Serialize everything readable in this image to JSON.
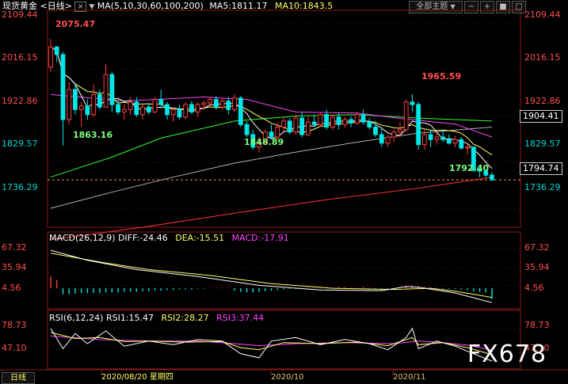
{
  "header": {
    "instrument": "现货黄金",
    "period": "<日线>",
    "ma_legend": "MA(5,10,30,60,100,200)",
    "ma5_label": "MA5:1811.17",
    "ma10_label": "MA10:1843.5",
    "subject_button": "全部主题",
    "dropdown_glyph": "▼",
    "close_glyph": "×"
  },
  "macd": {
    "title": "MACD(26,12,9)",
    "diff_label": "DIFF:-24.46",
    "dea_label": "DEA:-15.51",
    "macd_label": "MACD:-17.91",
    "levels": [
      "67.32",
      "35.94",
      "4.56"
    ]
  },
  "rsi": {
    "title": "RSI(6,12,24)",
    "rsi1_label": "RSI1:15.47",
    "rsi2_label": "RSI2:28.27",
    "rsi3_label": "RSI3:37.44",
    "levels": [
      "78.73",
      "47.10"
    ]
  },
  "price_axis": {
    "levels": [
      "2109.44",
      "2016.15",
      "1922.86",
      "1829.57",
      "1736.29"
    ],
    "current_box": "1904.41",
    "last_price_box": "1794.74"
  },
  "annotations": {
    "high": "2075.47",
    "low1": "1863.16",
    "low2": "1848.89",
    "high2": "1965.59",
    "low3": "1792.40"
  },
  "x_axis": {
    "period_button": "日线",
    "labels": [
      "2020/08/20 星期四",
      "2020/10",
      "2020/11"
    ]
  },
  "watermark": "FX678",
  "colors": {
    "up": "#ff3d3d",
    "down": "#00e6e6",
    "ma5": "#ffffff",
    "ma10": "#ffff66",
    "ma30": "#ff44ff",
    "ma60": "#33ff33",
    "ma100": "#b0b0b0",
    "ma200": "#ff3333",
    "diff": "#ffffff",
    "dea": "#ffff66",
    "rsi3": "#ff44ff"
  },
  "chart_data": [
    {
      "type": "candlestick",
      "title": "现货黄金 日线",
      "y_range": [
        1700,
        2130
      ],
      "candles": [
        {
          "o": 2020,
          "h": 2075.47,
          "l": 2010,
          "c": 2060
        },
        {
          "o": 2060,
          "h": 2062,
          "l": 2030,
          "c": 2045
        },
        {
          "o": 2045,
          "h": 2050,
          "l": 1863.16,
          "c": 1915
        },
        {
          "o": 1915,
          "h": 1990,
          "l": 1905,
          "c": 1975
        },
        {
          "o": 1975,
          "h": 1985,
          "l": 1925,
          "c": 1935
        },
        {
          "o": 1935,
          "h": 1950,
          "l": 1900,
          "c": 1942
        },
        {
          "o": 1942,
          "h": 1955,
          "l": 1915,
          "c": 1925
        },
        {
          "o": 1925,
          "h": 1985,
          "l": 1920,
          "c": 1965
        },
        {
          "o": 1965,
          "h": 1975,
          "l": 1935,
          "c": 1940
        },
        {
          "o": 1940,
          "h": 2025,
          "l": 1938,
          "c": 2005
        },
        {
          "o": 2005,
          "h": 2010,
          "l": 1930,
          "c": 1945
        },
        {
          "o": 1945,
          "h": 1955,
          "l": 1925,
          "c": 1930
        },
        {
          "o": 1930,
          "h": 1945,
          "l": 1915,
          "c": 1935
        },
        {
          "o": 1935,
          "h": 1960,
          "l": 1925,
          "c": 1950
        },
        {
          "o": 1950,
          "h": 1960,
          "l": 1920,
          "c": 1925
        },
        {
          "o": 1925,
          "h": 1945,
          "l": 1915,
          "c": 1940
        },
        {
          "o": 1940,
          "h": 1948,
          "l": 1925,
          "c": 1930
        },
        {
          "o": 1930,
          "h": 1960,
          "l": 1928,
          "c": 1955
        },
        {
          "o": 1955,
          "h": 1975,
          "l": 1940,
          "c": 1945
        },
        {
          "o": 1945,
          "h": 1950,
          "l": 1915,
          "c": 1925
        },
        {
          "o": 1925,
          "h": 1940,
          "l": 1910,
          "c": 1935
        },
        {
          "o": 1935,
          "h": 1945,
          "l": 1915,
          "c": 1920
        },
        {
          "o": 1920,
          "h": 1950,
          "l": 1915,
          "c": 1945
        },
        {
          "o": 1945,
          "h": 1952,
          "l": 1925,
          "c": 1930
        },
        {
          "o": 1930,
          "h": 1950,
          "l": 1920,
          "c": 1945
        },
        {
          "o": 1945,
          "h": 1952,
          "l": 1935,
          "c": 1948
        },
        {
          "o": 1948,
          "h": 1960,
          "l": 1940,
          "c": 1955
        },
        {
          "o": 1955,
          "h": 1962,
          "l": 1935,
          "c": 1940
        },
        {
          "o": 1940,
          "h": 1958,
          "l": 1935,
          "c": 1952
        },
        {
          "o": 1952,
          "h": 1960,
          "l": 1925,
          "c": 1935
        },
        {
          "o": 1935,
          "h": 1965,
          "l": 1930,
          "c": 1958
        },
        {
          "o": 1958,
          "h": 1962,
          "l": 1900,
          "c": 1905
        },
        {
          "o": 1905,
          "h": 1912,
          "l": 1880,
          "c": 1885
        },
        {
          "o": 1885,
          "h": 1895,
          "l": 1855,
          "c": 1860
        },
        {
          "o": 1860,
          "h": 1880,
          "l": 1848.89,
          "c": 1870
        },
        {
          "o": 1870,
          "h": 1895,
          "l": 1865,
          "c": 1890
        },
        {
          "o": 1890,
          "h": 1905,
          "l": 1875,
          "c": 1880
        },
        {
          "o": 1880,
          "h": 1910,
          "l": 1875,
          "c": 1900
        },
        {
          "o": 1900,
          "h": 1920,
          "l": 1890,
          "c": 1912
        },
        {
          "o": 1912,
          "h": 1918,
          "l": 1885,
          "c": 1890
        },
        {
          "o": 1890,
          "h": 1925,
          "l": 1885,
          "c": 1918
        },
        {
          "o": 1918,
          "h": 1930,
          "l": 1880,
          "c": 1885
        },
        {
          "o": 1885,
          "h": 1920,
          "l": 1882,
          "c": 1910
        },
        {
          "o": 1910,
          "h": 1925,
          "l": 1900,
          "c": 1905
        },
        {
          "o": 1905,
          "h": 1930,
          "l": 1900,
          "c": 1925
        },
        {
          "o": 1925,
          "h": 1935,
          "l": 1895,
          "c": 1900
        },
        {
          "o": 1900,
          "h": 1925,
          "l": 1895,
          "c": 1920
        },
        {
          "o": 1920,
          "h": 1928,
          "l": 1895,
          "c": 1905
        },
        {
          "o": 1905,
          "h": 1920,
          "l": 1898,
          "c": 1915
        },
        {
          "o": 1915,
          "h": 1922,
          "l": 1900,
          "c": 1908
        },
        {
          "o": 1908,
          "h": 1930,
          "l": 1905,
          "c": 1925
        },
        {
          "o": 1925,
          "h": 1935,
          "l": 1905,
          "c": 1910
        },
        {
          "o": 1910,
          "h": 1918,
          "l": 1895,
          "c": 1900
        },
        {
          "o": 1900,
          "h": 1912,
          "l": 1880,
          "c": 1885
        },
        {
          "o": 1885,
          "h": 1900,
          "l": 1860,
          "c": 1868
        },
        {
          "o": 1868,
          "h": 1885,
          "l": 1860,
          "c": 1880
        },
        {
          "o": 1880,
          "h": 1895,
          "l": 1870,
          "c": 1890
        },
        {
          "o": 1890,
          "h": 1910,
          "l": 1880,
          "c": 1895
        },
        {
          "o": 1895,
          "h": 1955,
          "l": 1890,
          "c": 1950
        },
        {
          "o": 1950,
          "h": 1965.59,
          "l": 1930,
          "c": 1945
        },
        {
          "o": 1945,
          "h": 1950,
          "l": 1855,
          "c": 1865
        },
        {
          "o": 1865,
          "h": 1895,
          "l": 1855,
          "c": 1885
        },
        {
          "o": 1885,
          "h": 1895,
          "l": 1860,
          "c": 1875
        },
        {
          "o": 1875,
          "h": 1890,
          "l": 1865,
          "c": 1880
        },
        {
          "o": 1880,
          "h": 1895,
          "l": 1870,
          "c": 1875
        },
        {
          "o": 1875,
          "h": 1885,
          "l": 1865,
          "c": 1868
        },
        {
          "o": 1868,
          "h": 1882,
          "l": 1860,
          "c": 1875
        },
        {
          "o": 1875,
          "h": 1880,
          "l": 1855,
          "c": 1858
        },
        {
          "o": 1858,
          "h": 1868,
          "l": 1845,
          "c": 1860
        },
        {
          "o": 1860,
          "h": 1862,
          "l": 1810,
          "c": 1815
        },
        {
          "o": 1815,
          "h": 1820,
          "l": 1800,
          "c": 1812
        },
        {
          "o": 1812,
          "h": 1815,
          "l": 1800,
          "c": 1804
        },
        {
          "o": 1804,
          "h": 1810,
          "l": 1792.4,
          "c": 1794.74
        }
      ],
      "ma_series": {
        "ma30": [
          [
            0,
            1965
          ],
          [
            12,
            1952
          ],
          [
            25,
            1960
          ],
          [
            32,
            1955
          ],
          [
            40,
            1930
          ],
          [
            50,
            1928
          ],
          [
            58,
            1916
          ],
          [
            66,
            1906
          ],
          [
            72,
            1880
          ]
        ],
        "ma60": [
          [
            0,
            1800
          ],
          [
            10,
            1840
          ],
          [
            18,
            1878
          ],
          [
            30,
            1912
          ],
          [
            40,
            1922
          ],
          [
            50,
            1925
          ],
          [
            60,
            1918
          ],
          [
            72,
            1912
          ]
        ],
        "ma100": [
          [
            0,
            1738
          ],
          [
            10,
            1770
          ],
          [
            20,
            1800
          ],
          [
            30,
            1828
          ],
          [
            40,
            1850
          ],
          [
            50,
            1870
          ],
          [
            60,
            1888
          ],
          [
            72,
            1900
          ]
        ],
        "ma200": [
          [
            0,
            1675
          ],
          [
            15,
            1700
          ],
          [
            30,
            1728
          ],
          [
            45,
            1755
          ],
          [
            60,
            1778
          ],
          [
            72,
            1800
          ]
        ]
      }
    },
    {
      "type": "macd",
      "title": "MACD(26,12,9)",
      "y_range": [
        -35,
        80
      ],
      "diff": [
        [
          0,
          65
        ],
        [
          6,
          48
        ],
        [
          14,
          32
        ],
        [
          24,
          20
        ],
        [
          34,
          5
        ],
        [
          44,
          -3
        ],
        [
          54,
          -4
        ],
        [
          58,
          3
        ],
        [
          60,
          2
        ],
        [
          66,
          -8
        ],
        [
          72,
          -24.46
        ]
      ],
      "dea": [
        [
          0,
          60
        ],
        [
          8,
          45
        ],
        [
          16,
          32
        ],
        [
          26,
          22
        ],
        [
          36,
          8
        ],
        [
          46,
          0
        ],
        [
          56,
          -2
        ],
        [
          62,
          0
        ],
        [
          66,
          -5
        ],
        [
          72,
          -15.51
        ]
      ],
      "hist": [
        [
          0,
          20
        ],
        [
          1,
          14
        ],
        [
          2,
          -10
        ],
        [
          3,
          -10
        ],
        [
          4,
          -9
        ],
        [
          5,
          -8
        ],
        [
          6,
          -8
        ],
        [
          7,
          -8
        ],
        [
          8,
          -8
        ],
        [
          9,
          -7
        ],
        [
          10,
          -7
        ],
        [
          11,
          -7
        ],
        [
          12,
          -6
        ],
        [
          13,
          -6
        ],
        [
          14,
          -6
        ],
        [
          15,
          -5
        ],
        [
          16,
          -5
        ],
        [
          17,
          -4
        ],
        [
          18,
          -4
        ],
        [
          19,
          -3
        ],
        [
          20,
          -3
        ],
        [
          21,
          -2
        ],
        [
          22,
          -2
        ],
        [
          23,
          -2
        ],
        [
          24,
          -1
        ],
        [
          25,
          -1
        ],
        [
          26,
          1
        ],
        [
          27,
          1
        ],
        [
          28,
          1
        ],
        [
          29,
          1
        ],
        [
          30,
          -4
        ],
        [
          31,
          -6
        ],
        [
          32,
          -7
        ],
        [
          33,
          -7
        ],
        [
          34,
          -6
        ],
        [
          35,
          -5
        ],
        [
          36,
          -4
        ],
        [
          37,
          -3
        ],
        [
          38,
          -2
        ],
        [
          39,
          -1
        ],
        [
          40,
          -1
        ],
        [
          41,
          -1
        ],
        [
          42,
          1
        ],
        [
          43,
          1
        ],
        [
          44,
          2
        ],
        [
          45,
          2
        ],
        [
          46,
          1
        ],
        [
          47,
          2
        ],
        [
          48,
          2
        ],
        [
          49,
          1
        ],
        [
          50,
          1
        ],
        [
          51,
          2
        ],
        [
          52,
          1
        ],
        [
          53,
          -1
        ],
        [
          54,
          -2
        ],
        [
          55,
          -2
        ],
        [
          56,
          -1
        ],
        [
          57,
          1
        ],
        [
          58,
          4
        ],
        [
          59,
          5
        ],
        [
          60,
          3
        ],
        [
          61,
          2
        ],
        [
          62,
          1
        ],
        [
          63,
          1
        ],
        [
          64,
          -1
        ],
        [
          65,
          -1
        ],
        [
          66,
          -1
        ],
        [
          67,
          -2
        ],
        [
          68,
          -3
        ],
        [
          69,
          -5
        ],
        [
          70,
          -6
        ],
        [
          71,
          -7
        ],
        [
          72,
          -17.91
        ]
      ]
    },
    {
      "type": "rsi",
      "title": "RSI(6,12,24)",
      "y_range": [
        0,
        100
      ],
      "rsi1": [
        [
          0,
          80
        ],
        [
          2,
          40
        ],
        [
          4,
          70
        ],
        [
          6,
          50
        ],
        [
          9,
          75
        ],
        [
          12,
          45
        ],
        [
          16,
          55
        ],
        [
          20,
          48
        ],
        [
          24,
          58
        ],
        [
          28,
          55
        ],
        [
          31,
          30
        ],
        [
          34,
          22
        ],
        [
          36,
          55
        ],
        [
          40,
          62
        ],
        [
          44,
          48
        ],
        [
          48,
          58
        ],
        [
          52,
          50
        ],
        [
          55,
          38
        ],
        [
          58,
          62
        ],
        [
          59,
          80
        ],
        [
          60,
          40
        ],
        [
          63,
          55
        ],
        [
          66,
          45
        ],
        [
          69,
          30
        ],
        [
          72,
          15.47
        ]
      ],
      "rsi2": [
        [
          0,
          72
        ],
        [
          4,
          60
        ],
        [
          8,
          62
        ],
        [
          12,
          54
        ],
        [
          16,
          55
        ],
        [
          22,
          53
        ],
        [
          28,
          54
        ],
        [
          31,
          42
        ],
        [
          34,
          38
        ],
        [
          38,
          52
        ],
        [
          44,
          50
        ],
        [
          50,
          53
        ],
        [
          55,
          46
        ],
        [
          59,
          62
        ],
        [
          60,
          48
        ],
        [
          64,
          52
        ],
        [
          68,
          42
        ],
        [
          72,
          28.27
        ]
      ],
      "rsi3": [
        [
          0,
          65
        ],
        [
          8,
          58
        ],
        [
          16,
          55
        ],
        [
          24,
          55
        ],
        [
          30,
          50
        ],
        [
          34,
          46
        ],
        [
          40,
          50
        ],
        [
          48,
          52
        ],
        [
          56,
          50
        ],
        [
          60,
          55
        ],
        [
          64,
          52
        ],
        [
          68,
          47
        ],
        [
          72,
          37.44
        ]
      ]
    }
  ]
}
